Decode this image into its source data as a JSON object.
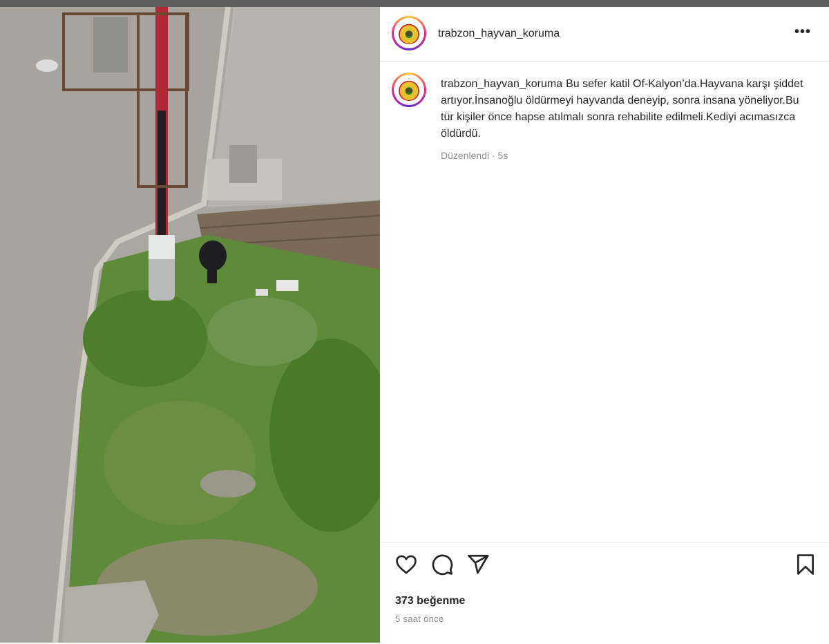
{
  "post": {
    "username": "trabzon_hayvan_koruma",
    "more_label": "•••",
    "caption_text": "Bu sefer katil Of-Kalyon’da.Hayvana karşı şiddet artıyor.İnsanoğlu öldürmeyi hayvanda deneyip, sonra insana yöneliyor.Bu tür kişiler önce hapse atılmalı sonra rehabilite edilmeli.Kediyi acımasızca öldürdü.",
    "edited_label": "Düzenlendi · 5s",
    "likes_label": "373 beğenme",
    "posted_ago": "5 saat önce"
  },
  "icons": {
    "avatar": "profile-avatar",
    "more": "more-options-icon",
    "like": "heart-icon",
    "comment": "comment-bubble-icon",
    "share": "paper-plane-icon",
    "save": "bookmark-icon"
  },
  "colors": {
    "text": "#262626",
    "secondary_text": "#8e8e8e",
    "divider": "#dbdbdb",
    "top_bar": "#5e5e5e"
  }
}
